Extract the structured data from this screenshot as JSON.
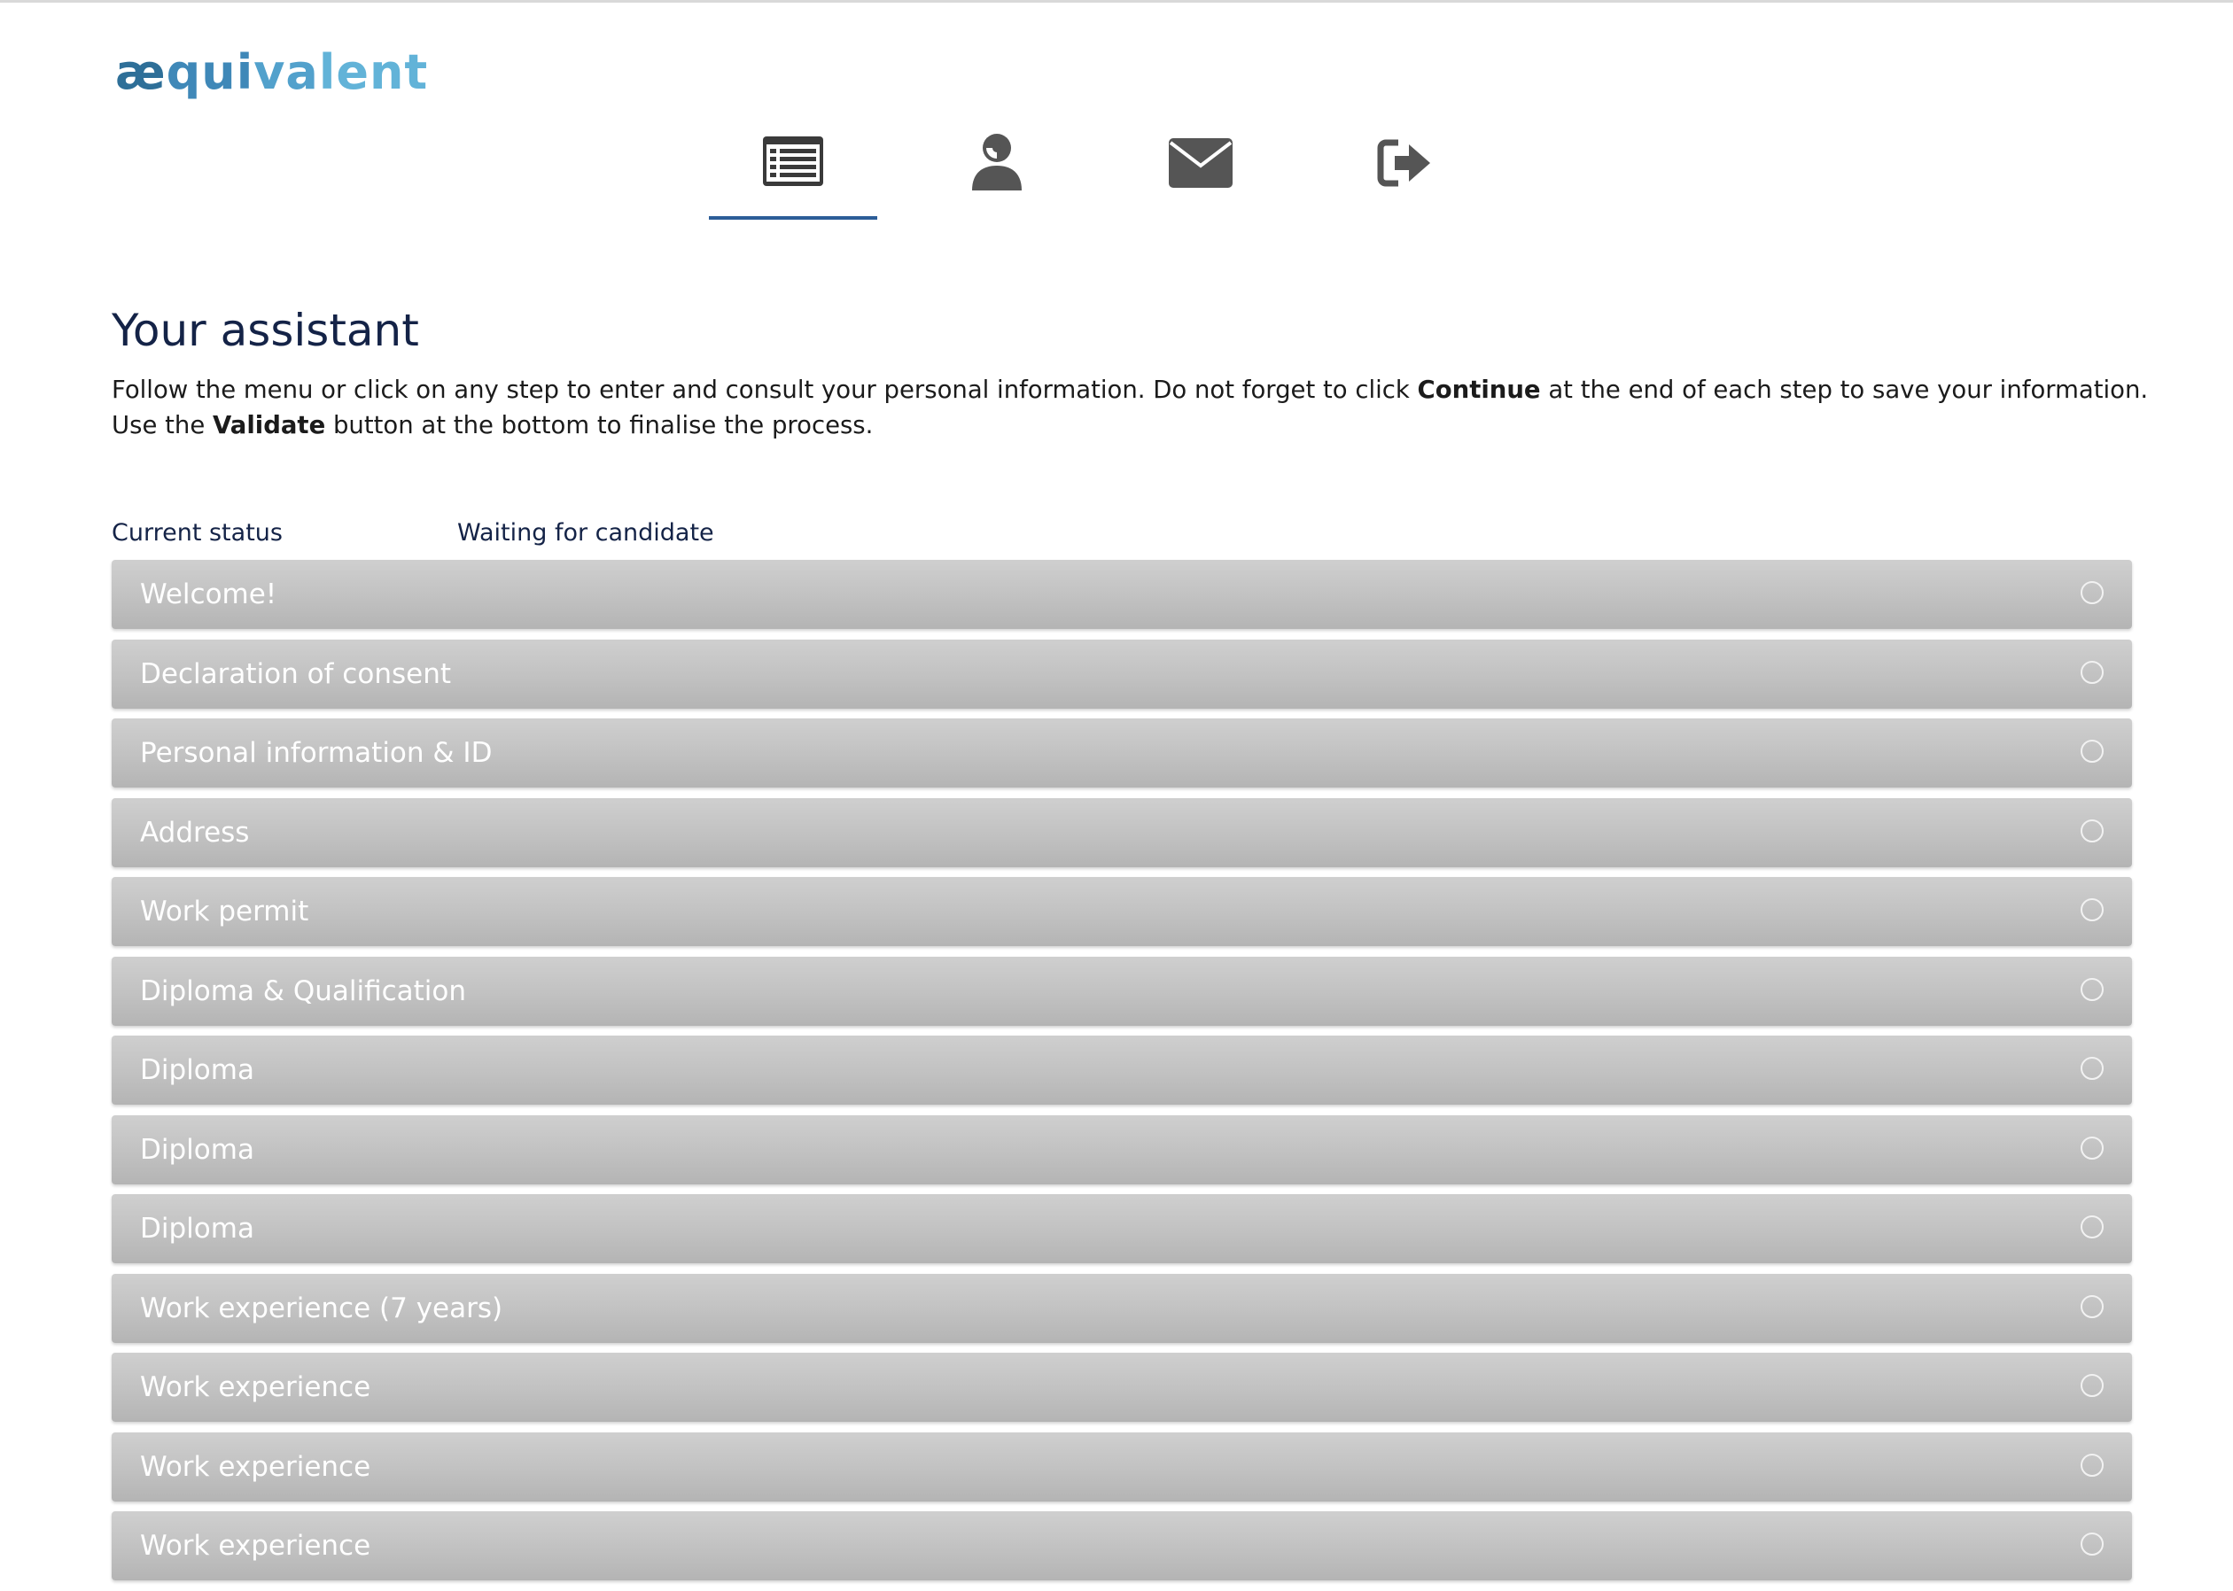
{
  "brand": {
    "logo_part1": "æ",
    "logo_part2": "qui",
    "logo_part3": "va",
    "logo_part4": "lent",
    "colors": {
      "primary_text": "#142347",
      "active_tab_underline": "#2c5d98",
      "logo_blue": "#3b8fc2",
      "step_bar": "#c1c1c1",
      "nav_icon": "#555555"
    }
  },
  "nav": {
    "tabs": [
      {
        "icon": "list-icon",
        "active": true
      },
      {
        "icon": "user-icon",
        "active": false
      },
      {
        "icon": "envelope-icon",
        "active": false
      },
      {
        "icon": "sign-out-icon",
        "active": false
      }
    ]
  },
  "page": {
    "title": "Your assistant",
    "intro": {
      "part1": "Follow the menu or click on any step to enter and consult your personal information. Do not forget to click ",
      "bold1": "Continue",
      "part2": " at the end of each step to save your information. Use the ",
      "bold2": "Validate",
      "part3": " button at the bottom to finalise the process."
    },
    "status": {
      "label": "Current status",
      "value": "Waiting for candidate"
    }
  },
  "steps": [
    {
      "label": "Welcome!"
    },
    {
      "label": "Declaration of consent"
    },
    {
      "label": "Personal information & ID"
    },
    {
      "label": "Address"
    },
    {
      "label": "Work permit"
    },
    {
      "label": "Diploma & Qualification"
    },
    {
      "label": "Diploma"
    },
    {
      "label": "Diploma"
    },
    {
      "label": "Diploma"
    },
    {
      "label": "Work experience (7 years)"
    },
    {
      "label": "Work experience"
    },
    {
      "label": "Work experience"
    },
    {
      "label": "Work experience"
    }
  ]
}
